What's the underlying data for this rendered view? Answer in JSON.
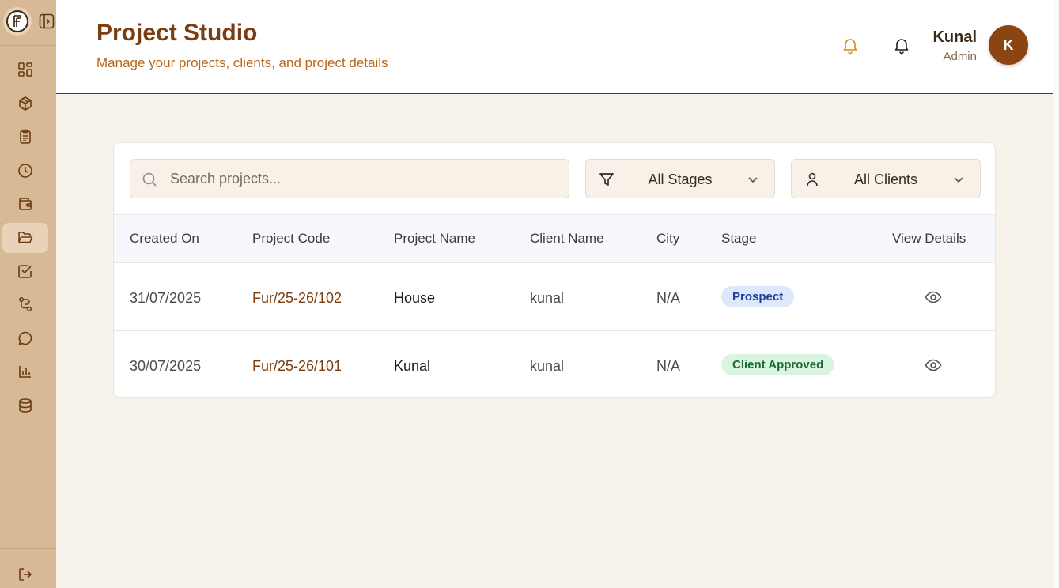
{
  "app": {
    "logo_icon": "brand-logo-icon",
    "colors": {
      "sidebar": "#d8b995",
      "accent": "#7a3e10",
      "background": "#f7f2ea"
    }
  },
  "sidebar": {
    "items": [
      {
        "icon": "dashboard-icon"
      },
      {
        "icon": "box-icon"
      },
      {
        "icon": "clipboard-icon"
      },
      {
        "icon": "clock-icon"
      },
      {
        "icon": "wallet-icon"
      },
      {
        "icon": "folder-open-icon",
        "active": true
      },
      {
        "icon": "checkbox-icon"
      },
      {
        "icon": "route-icon"
      },
      {
        "icon": "chat-icon"
      },
      {
        "icon": "bar-chart-icon"
      },
      {
        "icon": "database-icon"
      }
    ],
    "logout_icon": "logout-icon"
  },
  "header": {
    "title": "Project Studio",
    "subtitle": "Manage your projects, clients, and project details",
    "user": {
      "name": "Kunal",
      "role": "Admin",
      "initial": "K"
    }
  },
  "filters": {
    "search_placeholder": "Search projects...",
    "stage_label": "All Stages",
    "client_label": "All Clients"
  },
  "table": {
    "headers": [
      "Created On",
      "Project Code",
      "Project Name",
      "Client Name",
      "City",
      "Stage",
      "View Details"
    ],
    "rows": [
      {
        "created_on": "31/07/2025",
        "code": "Fur/25-26/102",
        "name": "House",
        "client": "kunal",
        "city": "N/A",
        "stage": "Prospect"
      },
      {
        "created_on": "30/07/2025",
        "code": "Fur/25-26/101",
        "name": "Kunal",
        "client": "kunal",
        "city": "N/A",
        "stage": "Client Approved"
      }
    ]
  }
}
